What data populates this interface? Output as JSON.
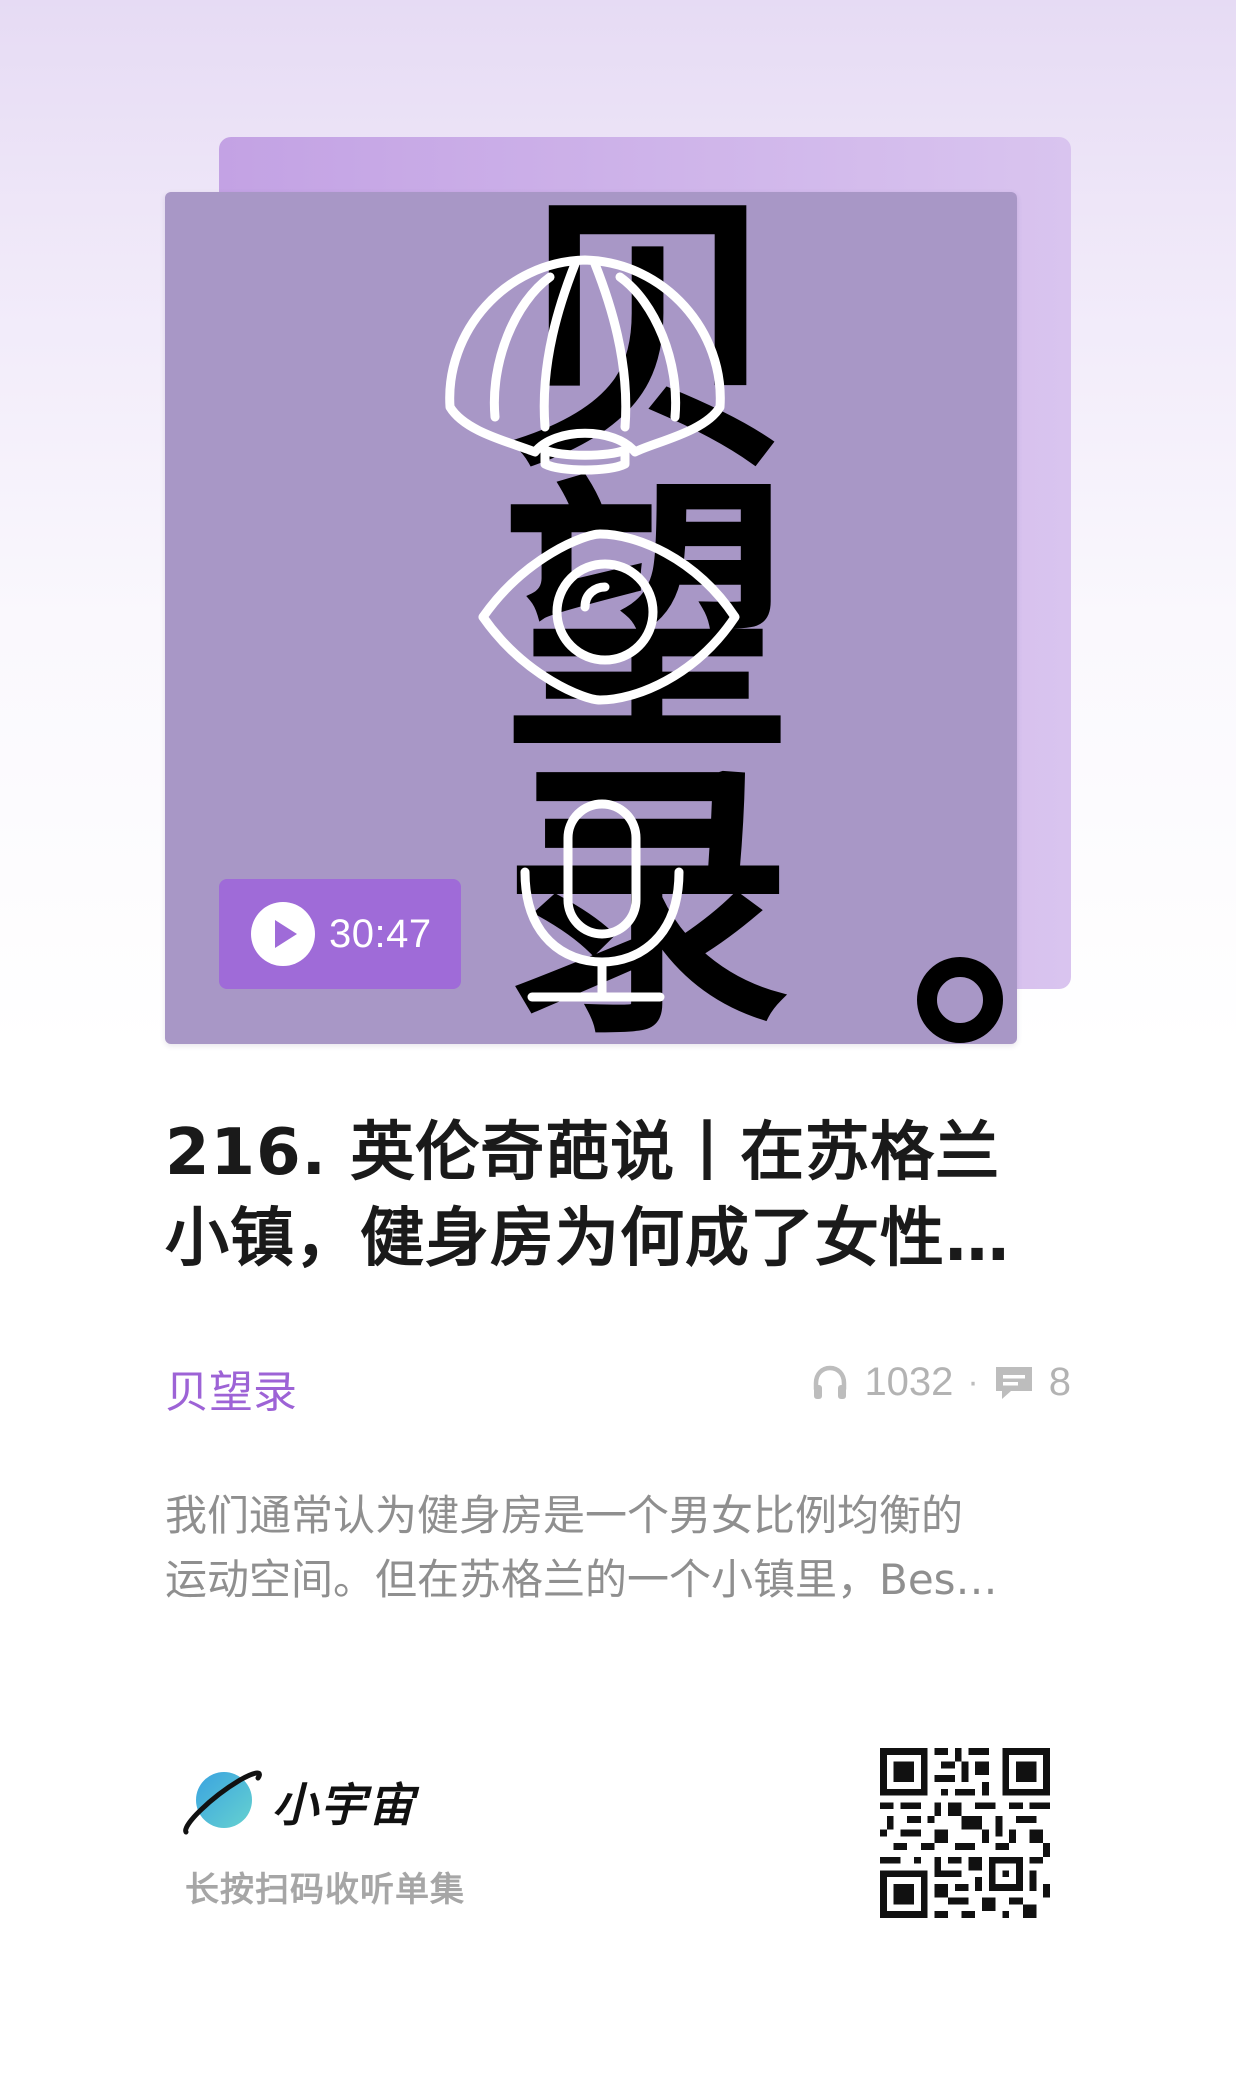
{
  "cover": {
    "duration": "30:47",
    "art_text": [
      "贝",
      "望",
      "录",
      "。"
    ],
    "icons": [
      "shell-icon",
      "eye-icon",
      "microphone-icon"
    ]
  },
  "episode": {
    "title_line1": "216. 英伦奇葩说丨在苏格兰",
    "title_line2": "小镇，健身房为何成了女性…",
    "podcast_name": "贝望录",
    "listen_count": "1032",
    "separator": "·",
    "comment_count": "8",
    "description_line1": "我们通常认为健身房是一个男女比例均衡的",
    "description_line2": "运动空间。但在苏格兰的一个小镇里，Bes…"
  },
  "footer": {
    "brand_name": "小宇宙",
    "hint": "长按扫码收听单集"
  },
  "colors": {
    "accent": "#9d63d6",
    "cover_bg": "#a897c6",
    "cover_back": "#c3a2e4",
    "pill": "#9f6bd8"
  }
}
